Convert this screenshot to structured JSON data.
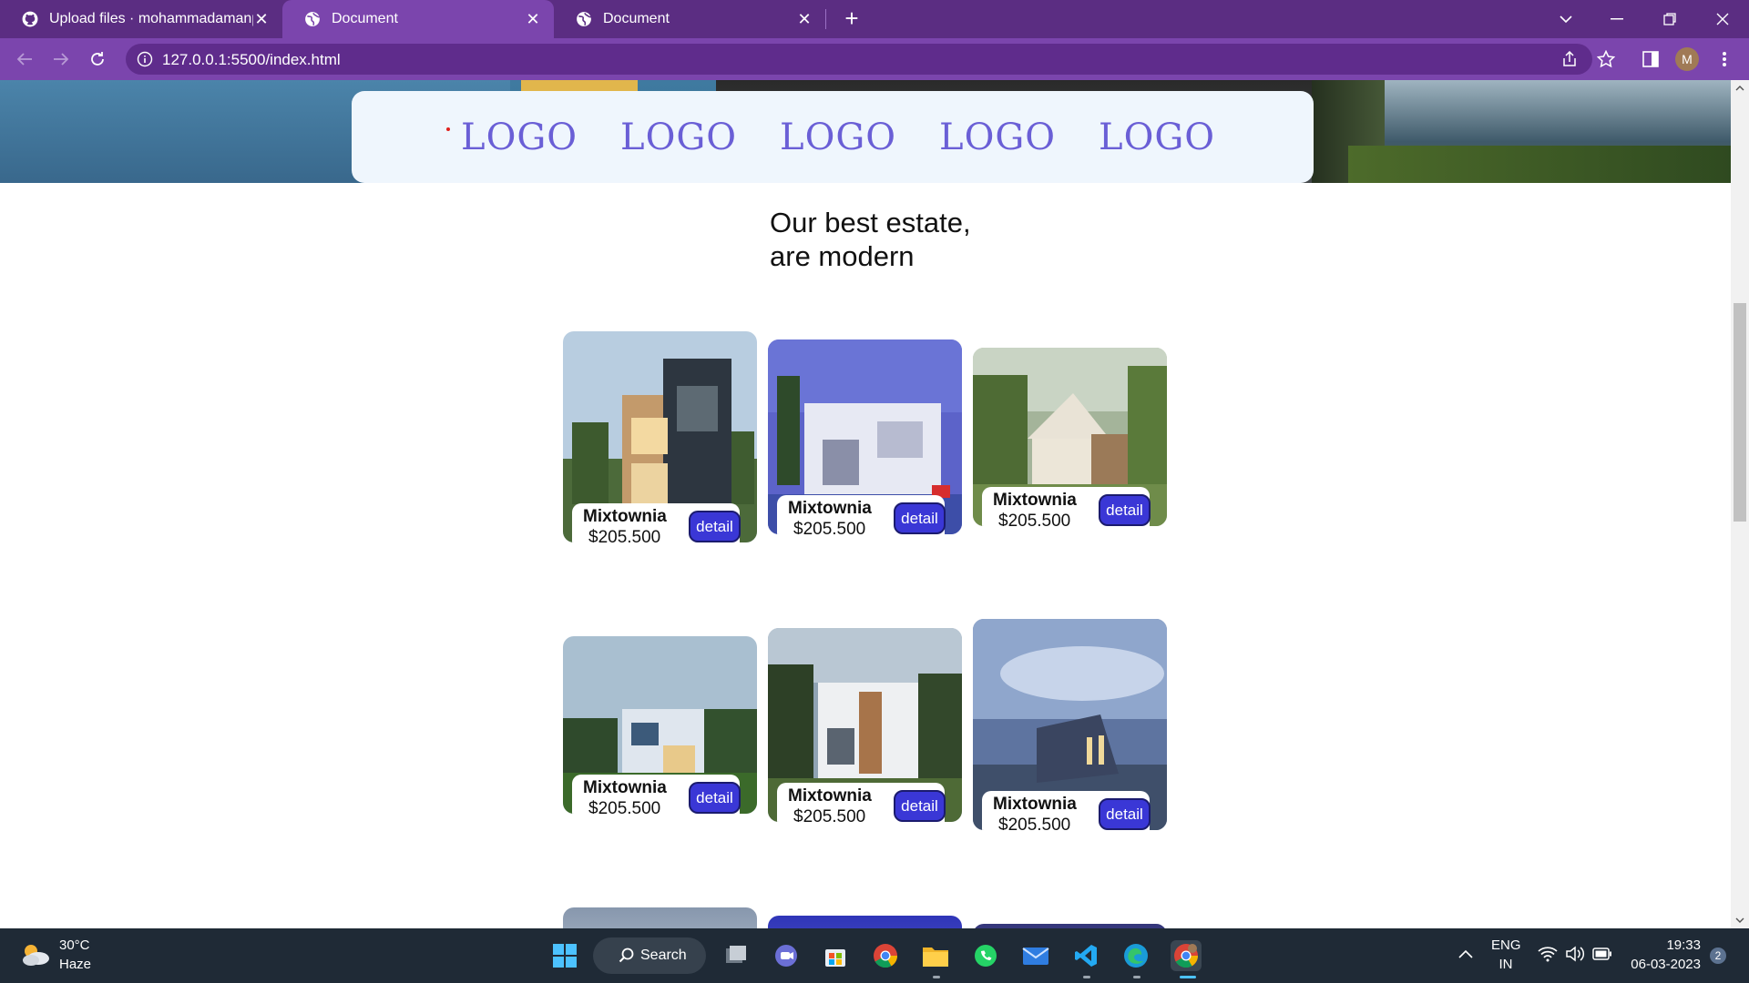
{
  "browser": {
    "tabs": [
      {
        "title": "Upload files · mohammadamanp",
        "icon": "github-icon",
        "active": false
      },
      {
        "title": "Document",
        "icon": "globe-icon",
        "active": true
      },
      {
        "title": "Document",
        "icon": "globe-icon",
        "active": false
      }
    ],
    "url": "127.0.0.1:5500/index.html",
    "profile_initial": "M"
  },
  "page": {
    "logos": [
      "LOGO",
      "LOGO",
      "LOGO",
      "LOGO",
      "LOGO"
    ],
    "headline_line1": "Our best estate,",
    "headline_line2": "are modern",
    "cards": [
      {
        "name": "Mixtownia",
        "price": "$205,500",
        "button": "detail",
        "image": "house-photo"
      },
      {
        "name": "Mixtownia",
        "price": "$205,500",
        "button": "detail",
        "image": "house-photo"
      },
      {
        "name": "Mixtownia",
        "price": "$205,500",
        "button": "detail",
        "image": "house-photo"
      },
      {
        "name": "Mixtownia",
        "price": "$205,500",
        "button": "detail",
        "image": "house-photo"
      },
      {
        "name": "Mixtownia",
        "price": "$205,500",
        "button": "detail",
        "image": "house-photo"
      },
      {
        "name": "Mixtownia",
        "price": "$205,500",
        "button": "detail",
        "image": "house-photo"
      }
    ]
  },
  "taskbar": {
    "weather_temp": "30°C",
    "weather_condition": "Haze",
    "search_label": "Search",
    "language_line1": "ENG",
    "language_line2": "IN",
    "time": "19:33",
    "date": "06-03-2023",
    "notification_count": "2"
  },
  "colors": {
    "browser_frame": "#5b2d82",
    "browser_toolbar": "#7b45ad",
    "logo_text": "#6a5fd6",
    "detail_button": "#3a37d6",
    "taskbar": "#1f2a36"
  }
}
